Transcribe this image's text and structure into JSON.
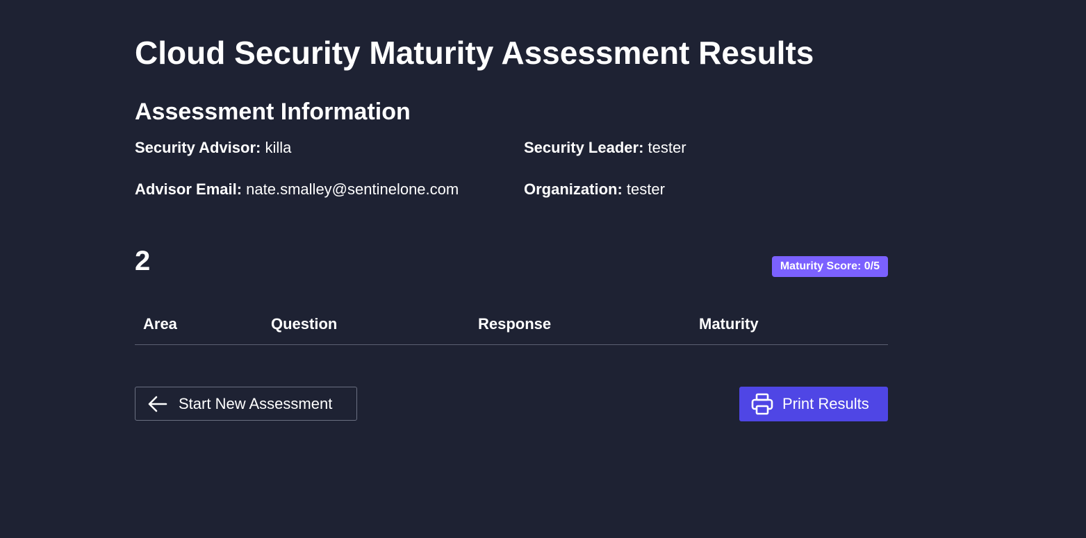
{
  "page": {
    "title": "Cloud Security Maturity Assessment Results"
  },
  "assessment_info": {
    "heading": "Assessment Information",
    "security_advisor": {
      "label": "Security Advisor:",
      "value": "killa"
    },
    "security_leader": {
      "label": "Security Leader:",
      "value": "tester"
    },
    "advisor_email": {
      "label": "Advisor Email:",
      "value": "nate.smalley@sentinelone.com"
    },
    "organization": {
      "label": "Organization:",
      "value": "tester"
    }
  },
  "section": {
    "number": "2",
    "maturity_badge": "Maturity Score: 0/5",
    "badge_color": "#7b61ff",
    "table": {
      "columns": [
        "Area",
        "Question",
        "Response",
        "Maturity"
      ],
      "rows": []
    }
  },
  "actions": {
    "start_new": {
      "label": "Start New Assessment",
      "icon": "arrow-left-icon"
    },
    "print": {
      "label": "Print Results",
      "icon": "printer-icon",
      "color": "#4f46e5"
    }
  }
}
